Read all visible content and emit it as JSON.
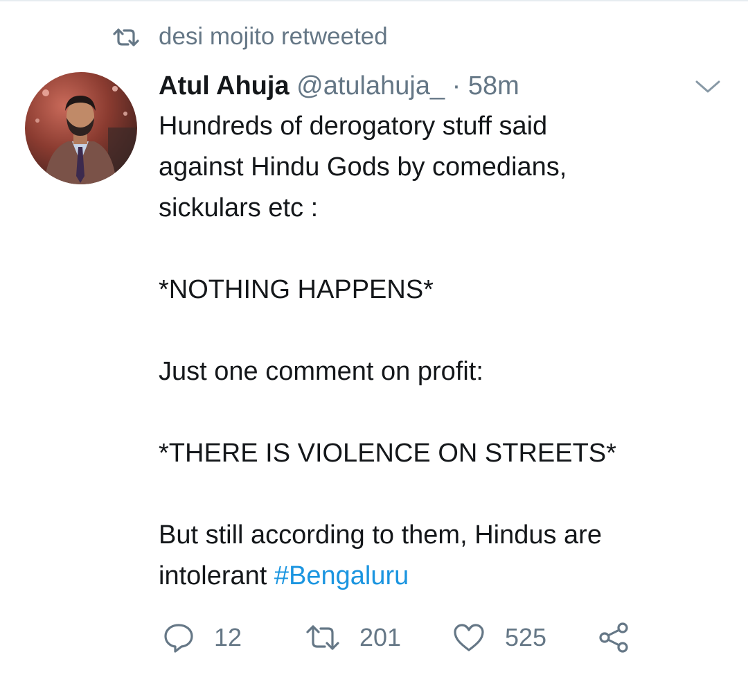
{
  "retweet_context": {
    "text": "desi mojito retweeted",
    "icon": "retweet-icon"
  },
  "tweet": {
    "author": {
      "display_name": "Atul Ahuja",
      "handle": "@atulahuja_",
      "separator": "·",
      "time": "58m"
    },
    "text_main": "Hundreds of derogatory stuff said\nagainst Hindu Gods by comedians,\nsickulars etc :\n\n*NOTHING HAPPENS*\n\nJust one comment on profit:\n\n*THERE IS VIOLENCE ON STREETS*\n\nBut still according to them, Hindus are\nintolerant ",
    "hashtag": "#Bengaluru",
    "menu_icon": "chevron-down-icon"
  },
  "actions": {
    "reply": {
      "icon": "reply-icon",
      "count": "12"
    },
    "retweet": {
      "icon": "retweet-icon",
      "count": "201"
    },
    "like": {
      "icon": "heart-icon",
      "count": "525"
    },
    "share": {
      "icon": "share-icon"
    }
  },
  "colors": {
    "text": "#14171a",
    "secondary": "#657786",
    "link": "#1b95e0"
  }
}
